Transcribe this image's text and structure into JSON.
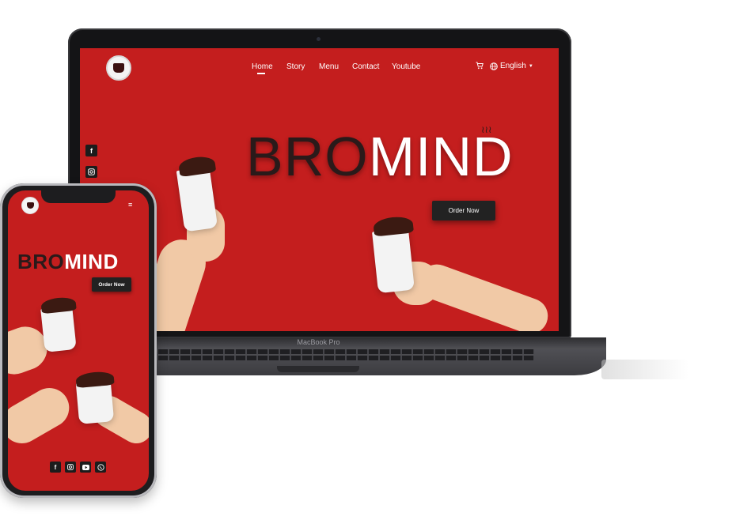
{
  "laptop": {
    "device_label": "MacBook Pro",
    "nav": {
      "links": [
        "Home",
        "Story",
        "Menu",
        "Contact",
        "Youtube"
      ],
      "language": "English",
      "icons": [
        "cart-icon",
        "globe-icon",
        "caret-down-icon"
      ]
    },
    "hero": {
      "brand_dark": "BRO",
      "brand_light": "MIND",
      "cta": "Order Now"
    },
    "social": [
      "facebook-icon",
      "instagram-icon"
    ]
  },
  "phone": {
    "hero": {
      "brand_dark": "BRO",
      "brand_light": "MIND",
      "cta": "Order Now"
    },
    "social": [
      "facebook-icon",
      "instagram-icon",
      "youtube-icon",
      "whatsapp-icon"
    ]
  },
  "colors": {
    "brand_red": "#c41e1e",
    "dark": "#222222",
    "light": "#ffffff"
  }
}
